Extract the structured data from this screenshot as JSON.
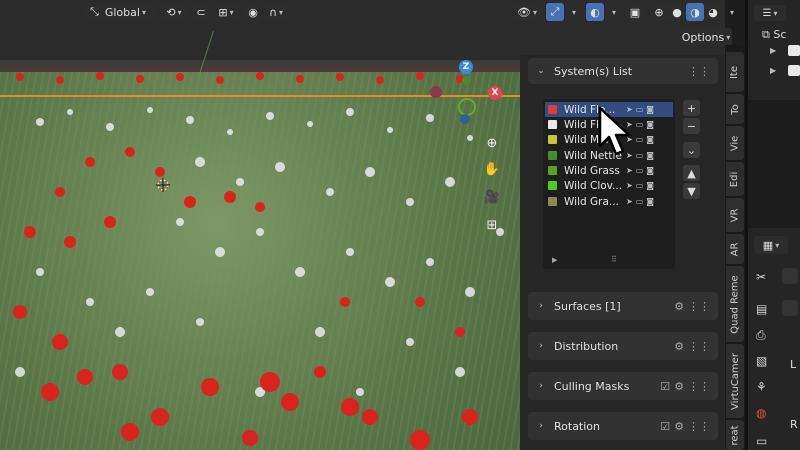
{
  "header": {
    "orientation": "Global",
    "options": "Options"
  },
  "gizmo": {
    "z": "Z",
    "x": "X",
    "y": ""
  },
  "npanel": {
    "system_list": {
      "title": "System(s) List",
      "items": [
        {
          "name": "Wild Flo...",
          "color": "#e23b3b",
          "active": true
        },
        {
          "name": "Wild Flo...",
          "color": "#e8e8e8",
          "active": false
        },
        {
          "name": "Wild Me...",
          "color": "#c9c43a",
          "active": false
        },
        {
          "name": "Wild Nettle",
          "color": "#3f8f2a",
          "active": false
        },
        {
          "name": "Wild Grass",
          "color": "#5fa022",
          "active": false
        },
        {
          "name": "Wild Clov...",
          "color": "#4ecc1a",
          "active": false
        },
        {
          "name": "Wild Gra...",
          "color": "#8a8a55",
          "active": false
        }
      ]
    },
    "sections": [
      {
        "label": "Surfaces [1]"
      },
      {
        "label": "Distribution"
      },
      {
        "label": "Culling Masks"
      },
      {
        "label": "Rotation"
      }
    ]
  },
  "tabs": [
    "Ite",
    "To",
    "Vie",
    "Edi",
    "VR",
    "AR",
    "Quad Reme",
    "VirtuCamer",
    "reat"
  ],
  "outliner": {
    "scene_label": "Sc"
  },
  "props": {
    "label_l": "L",
    "label_r": "R"
  },
  "colors": {
    "accent": "#4772b3",
    "panel_bg": "#262626",
    "header_bg": "#323232",
    "active_row": "#334d80",
    "x_axis": "#e8414f",
    "y_axis": "#67a92c",
    "z_axis": "#3a8be0"
  }
}
